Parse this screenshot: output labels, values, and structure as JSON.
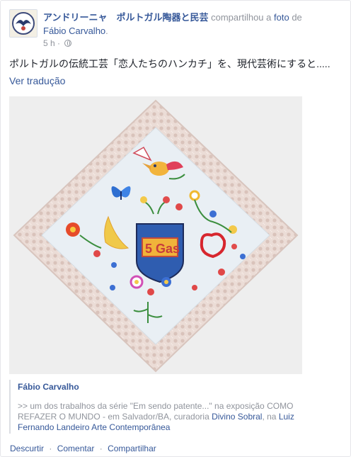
{
  "header": {
    "page_name": "アンドリーニャ　ポルトガル陶器と民芸",
    "action_text": "compartilhou a",
    "photo_link": "foto",
    "connector": "de",
    "owner": "Fábio Carvalho",
    "time": "5 h",
    "separator": "·"
  },
  "post": {
    "message": "ポルトガルの伝統工芸「恋人たちのハンカチ」を、現代芸術にすると.....",
    "translate_label": "Ver tradução"
  },
  "attachment": {
    "author": "Fábio Carvalho",
    "text_1": ">> um dos trabalhos da série \"Em sendo patente...\" na exposição COMO REFAZER O MUNDO - em Salvador/BA, curadoria",
    "link_1": "Divino Sobral",
    "text_2": ", na",
    "link_2": "Luiz Fernando Landeiro Arte Contemporânea"
  },
  "photo": {
    "embroidered_text": "5 Gas"
  },
  "actions": {
    "like": "Descurtir",
    "comment": "Comentar",
    "share": "Compartilhar",
    "separator": "·"
  },
  "colors": {
    "link": "#365899",
    "meta": "#90949c",
    "text": "#1d2129",
    "lace": "#e7d9d3",
    "cloth": "#e9eff4"
  },
  "icons": {
    "privacy": "globe-icon"
  }
}
